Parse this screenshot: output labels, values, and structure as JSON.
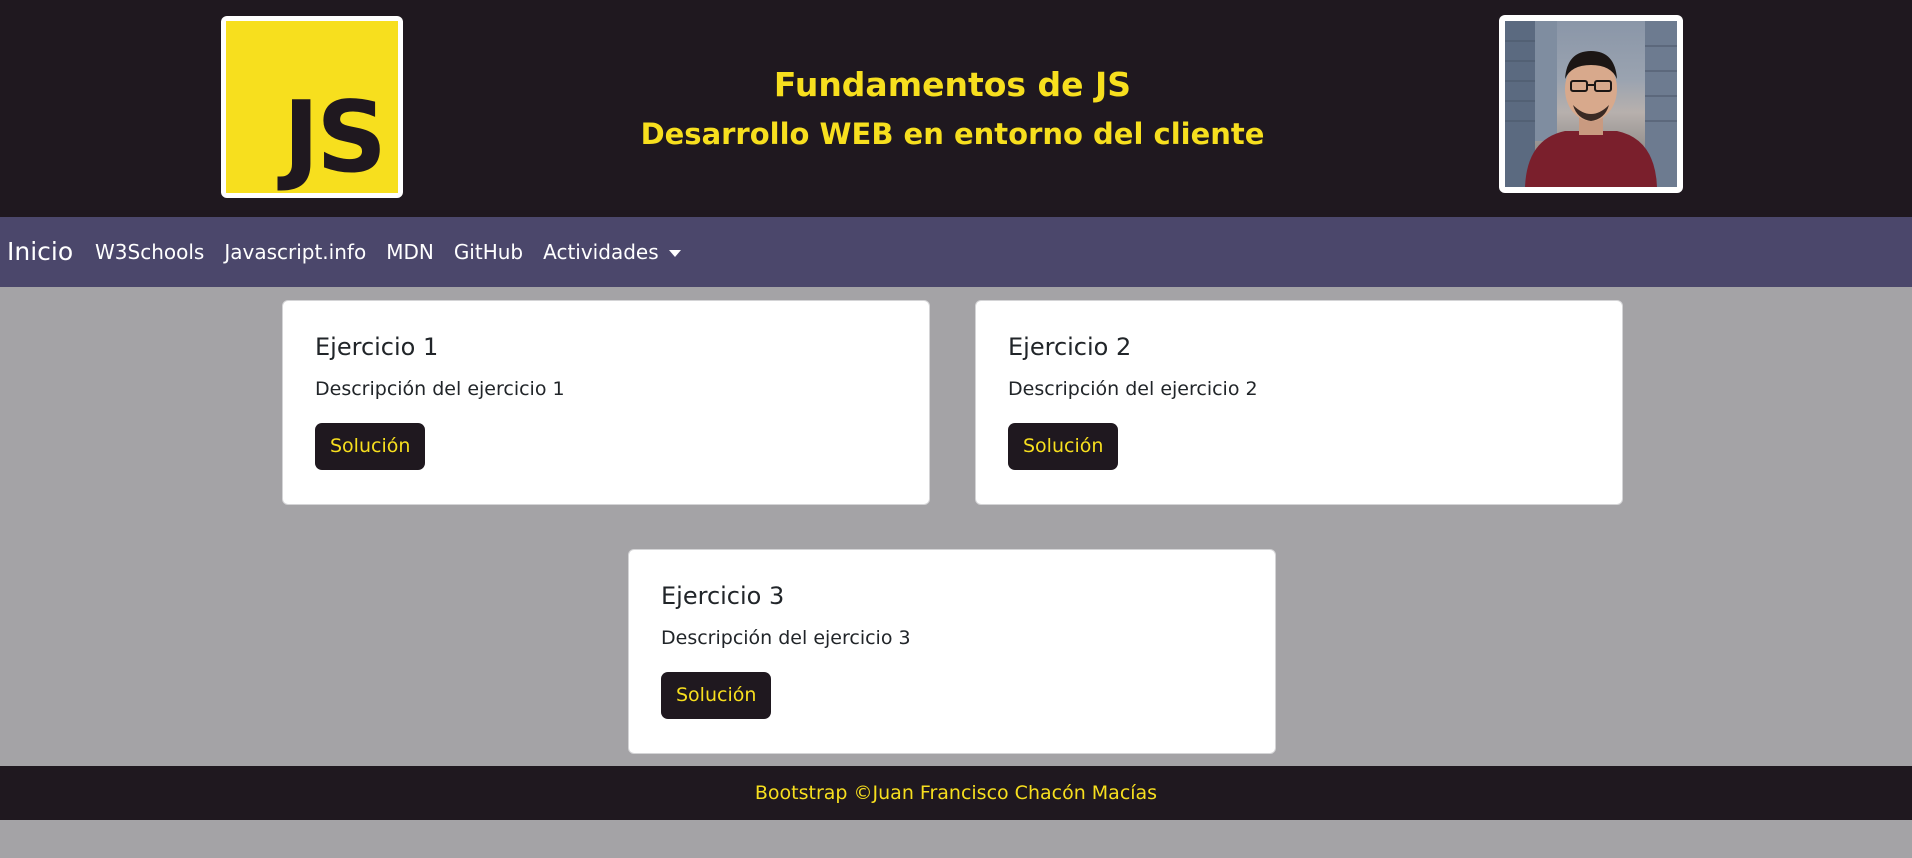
{
  "header": {
    "logo_text": "JS",
    "title": "Fundamentos de JS",
    "subtitle": "Desarrollo WEB en entorno del cliente"
  },
  "navbar": {
    "brand": "Inicio",
    "links": [
      "W3Schools",
      "Javascript.info",
      "MDN",
      "GitHub"
    ],
    "dropdown_label": "Actividades"
  },
  "cards": [
    {
      "title": "Ejercicio 1",
      "text": "Descripción del ejercicio 1",
      "button": "Solución"
    },
    {
      "title": "Ejercicio 2",
      "text": "Descripción del ejercicio 2",
      "button": "Solución"
    },
    {
      "title": "Ejercicio 3",
      "text": "Descripción del ejercicio 3",
      "button": "Solución"
    }
  ],
  "footer": {
    "text": "Bootstrap ©Juan Francisco Chacón Macías"
  },
  "colors": {
    "dark": "#1f181f",
    "accent": "#f7df1e",
    "navbar": "#4b476b",
    "page_background": "#a4a3a6"
  }
}
